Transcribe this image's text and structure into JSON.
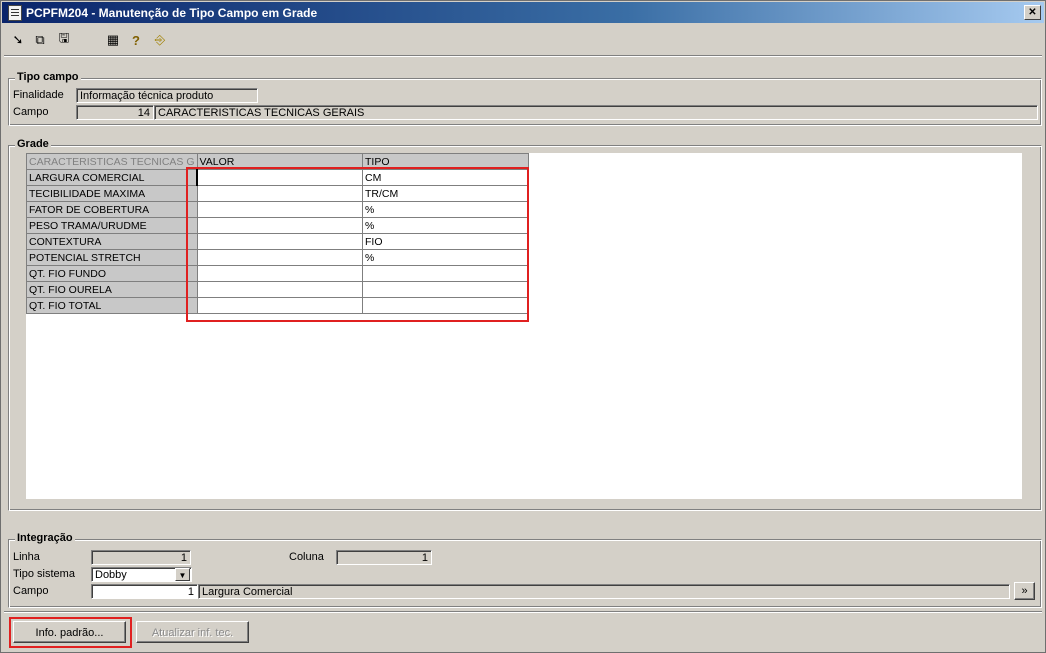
{
  "window": {
    "title": "PCPFM204 - Manutenção de Tipo Campo em Grade",
    "close_label": "✕"
  },
  "toolbar": {
    "icons": [
      "arrow-right-icon",
      "copy-icon",
      "save-icon",
      "calendar-icon",
      "help-icon",
      "exit-door-icon"
    ],
    "glyphs": [
      "➘",
      "⧉",
      "🖫",
      "▦",
      "?",
      "⎆"
    ]
  },
  "tipo_campo": {
    "legend": "Tipo campo",
    "finalidade_label": "Finalidade",
    "finalidade_value": "Informação técnica produto",
    "campo_label": "Campo",
    "campo_number": "14",
    "campo_desc": "CARACTERISTICAS TECNICAS GERAIS"
  },
  "grade": {
    "legend": "Grade",
    "headers": [
      "CARACTERISTICAS TECNICAS G",
      "VALOR",
      "TIPO"
    ],
    "rows": [
      {
        "label": "LARGURA COMERCIAL",
        "valor": "",
        "tipo": "CM"
      },
      {
        "label": "TECIBILIDADE MAXIMA",
        "valor": "",
        "tipo": "TR/CM"
      },
      {
        "label": "FATOR DE COBERTURA",
        "valor": "",
        "tipo": "%"
      },
      {
        "label": "PESO TRAMA/URUDME",
        "valor": "",
        "tipo": "%"
      },
      {
        "label": "CONTEXTURA",
        "valor": "",
        "tipo": "FIO"
      },
      {
        "label": "POTENCIAL STRETCH",
        "valor": "",
        "tipo": "%"
      },
      {
        "label": "QT. FIO FUNDO",
        "valor": "",
        "tipo": ""
      },
      {
        "label": "QT. FIO OURELA",
        "valor": "",
        "tipo": ""
      },
      {
        "label": "QT. FIO TOTAL",
        "valor": "",
        "tipo": ""
      }
    ]
  },
  "integracao": {
    "legend": "Integração",
    "linha_label": "Linha",
    "linha_value": "1",
    "coluna_label": "Coluna",
    "coluna_value": "1",
    "tipo_sistema_label": "Tipo sistema",
    "tipo_sistema_value": "Dobby",
    "campo_label": "Campo",
    "campo_value": "1",
    "campo_desc": "Largura Comercial",
    "more_label": "»"
  },
  "buttons": {
    "info_padrao": "Info. padrão...",
    "atualizar": "Atualizar inf. tec."
  },
  "colors": {
    "highlight": "#e02020",
    "title_bar": "#0a246a"
  }
}
